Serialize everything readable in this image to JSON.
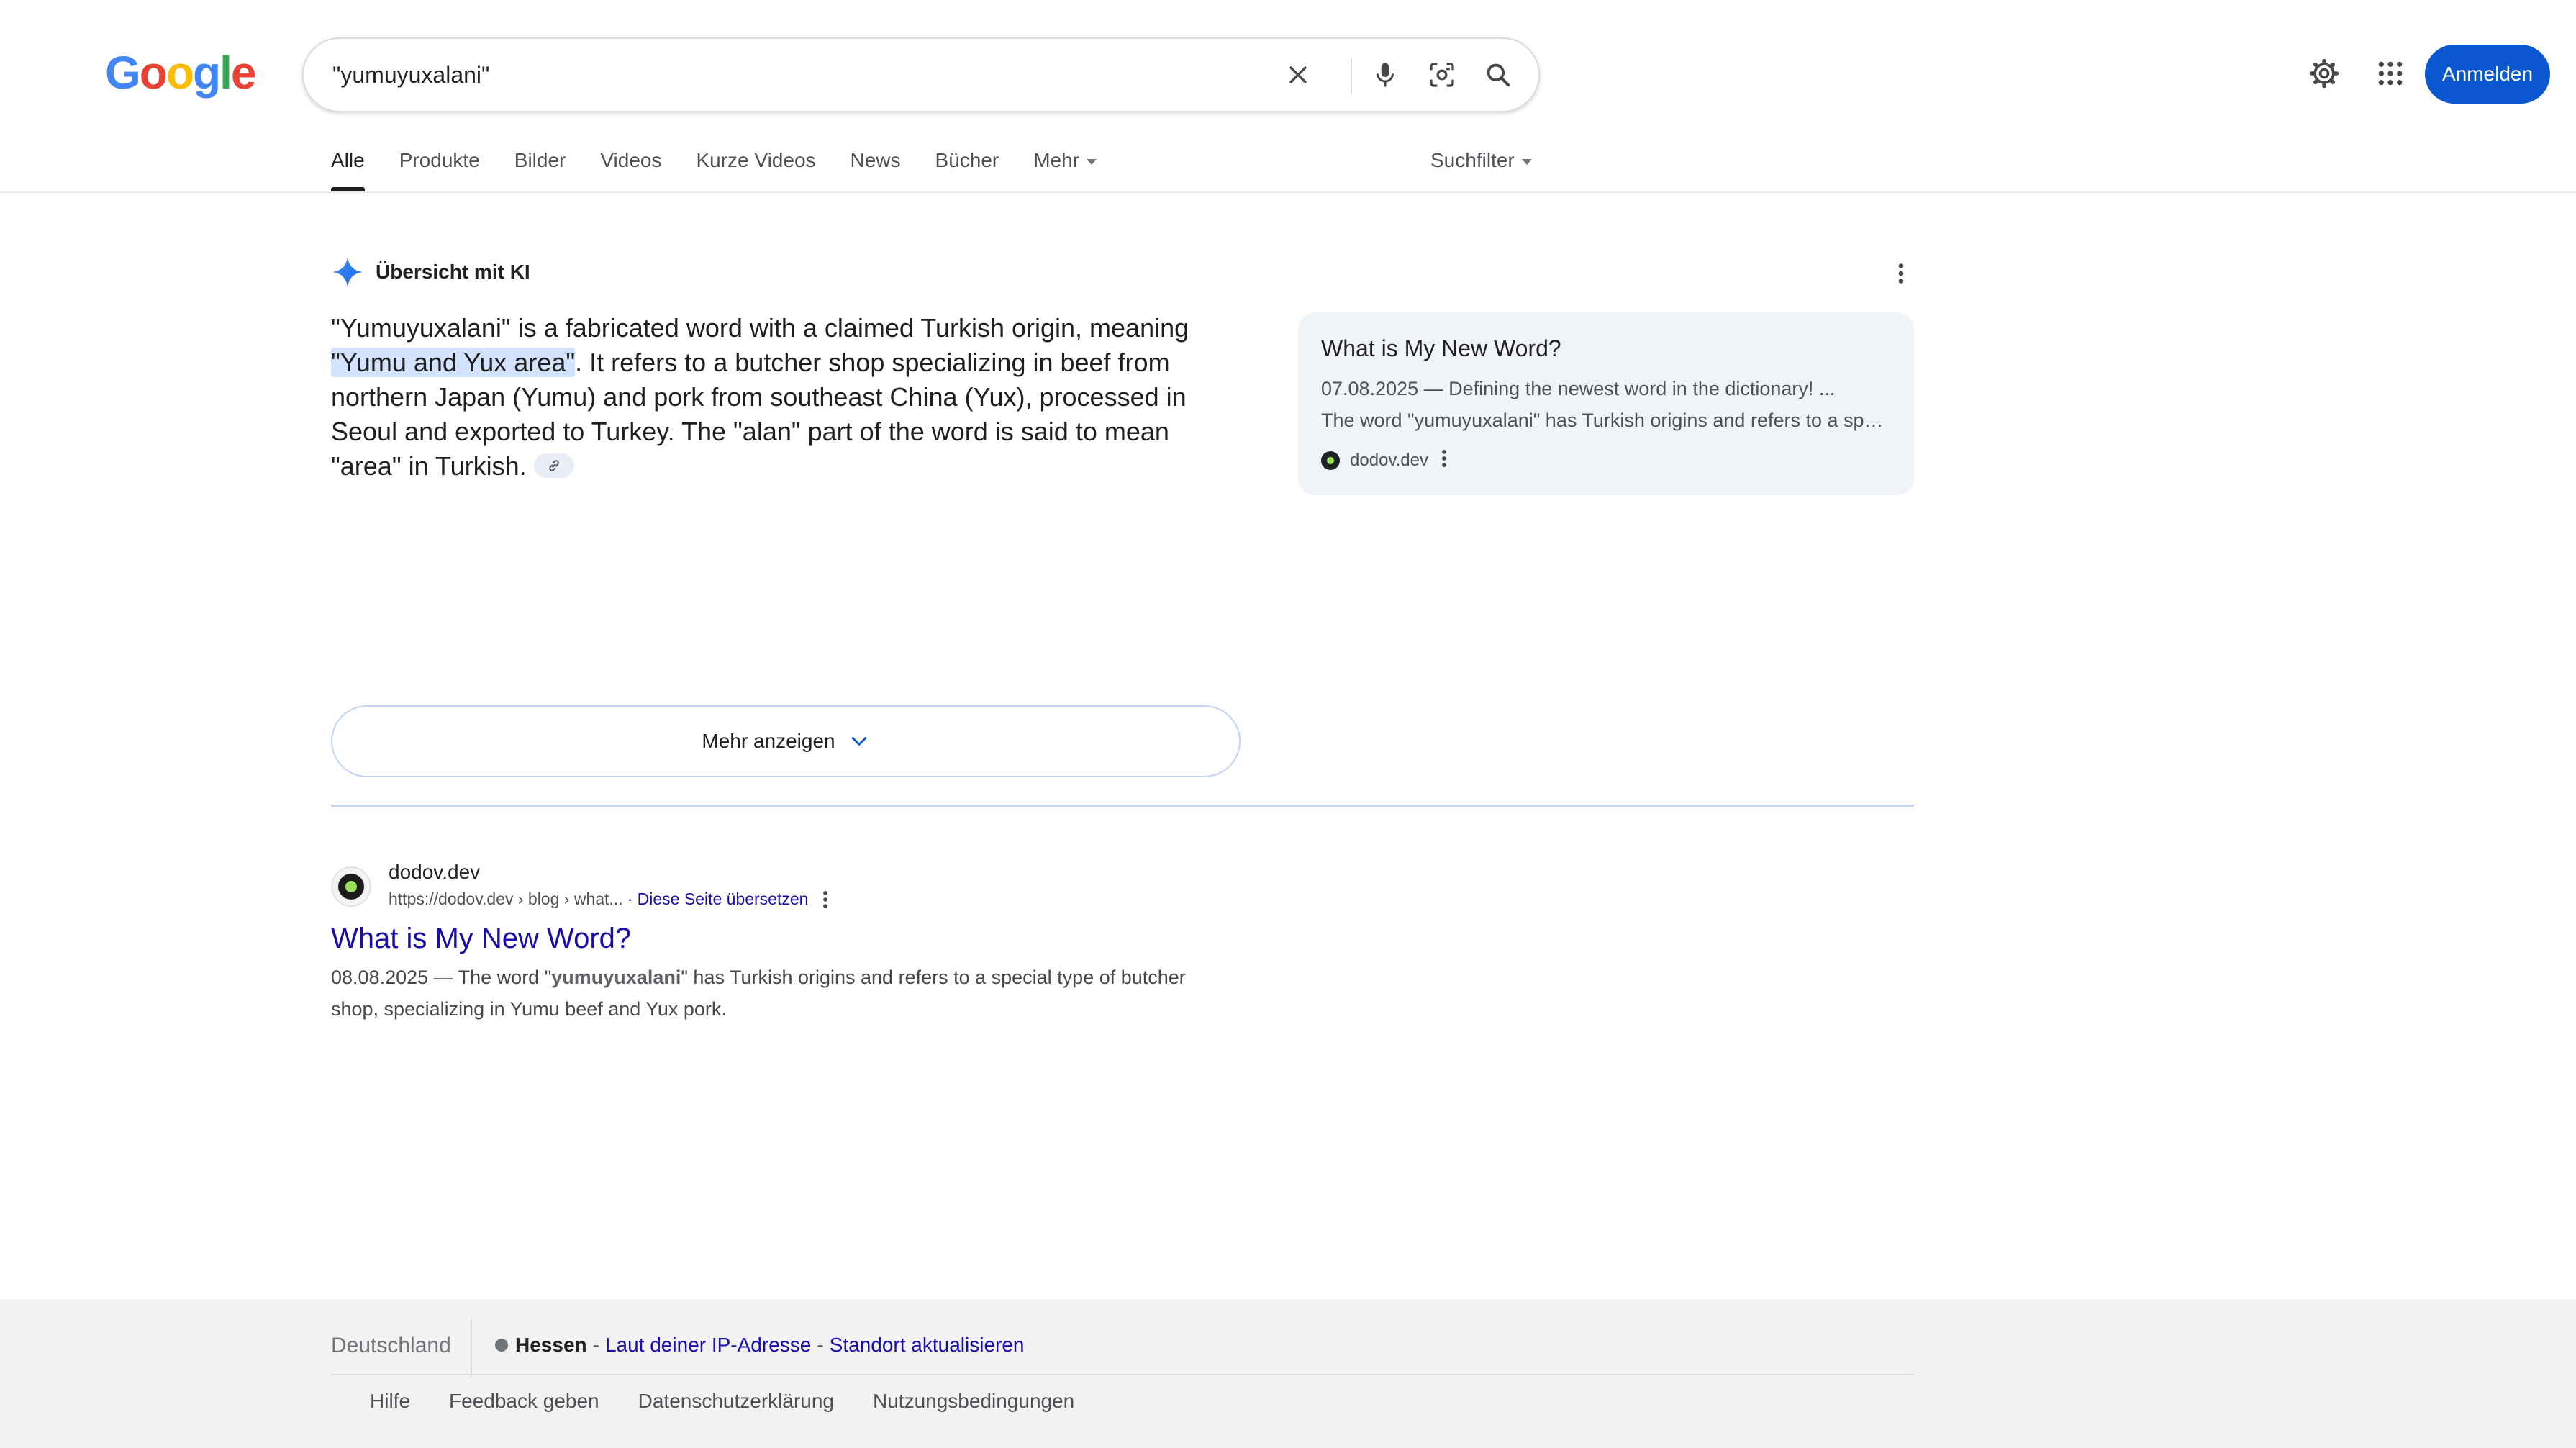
{
  "header": {
    "logo": {
      "letters": [
        {
          "char": "G",
          "color": "#4285f4"
        },
        {
          "char": "o",
          "color": "#ea4335"
        },
        {
          "char": "o",
          "color": "#fbbc05"
        },
        {
          "char": "g",
          "color": "#4285f4"
        },
        {
          "char": "l",
          "color": "#34a853"
        },
        {
          "char": "e",
          "color": "#ea4335"
        }
      ]
    },
    "search": {
      "query": "\"yumuyuxalani\"",
      "icons": [
        "close-icon",
        "microphone-icon",
        "lens-icon",
        "search-icon"
      ]
    },
    "icons": [
      "settings-icon",
      "apps-grid-icon"
    ],
    "signin_label": "Anmelden"
  },
  "tabs": [
    {
      "label": "Alle",
      "active": true
    },
    {
      "label": "Produkte"
    },
    {
      "label": "Bilder"
    },
    {
      "label": "Videos"
    },
    {
      "label": "Kurze Videos"
    },
    {
      "label": "News"
    },
    {
      "label": "Bücher"
    },
    {
      "label": "Mehr"
    }
  ],
  "filter_label": "Suchfilter",
  "ai_overview": {
    "title": "Übersicht mit KI",
    "text_before": "\"Yumuyuxalani\" is a fabricated word with a claimed Turkish origin, meaning ",
    "text_highlight": "\"Yumu and Yux area\"",
    "text_after": ". It refers to a butcher shop specializing in beef from northern Japan (Yumu) and pork from southeast China (Yux), processed in Seoul and exported to Turkey. The \"alan\" part of the word is said to mean \"area\" in Turkish.",
    "source_card": {
      "title": "What is My New Word?",
      "line1": "07.08.2025 — Defining the newest word in the dictionary! ...",
      "line2": "The word \"yumuyuxalani\" has Turkish origins and refers to a special type of butcher shop, specializing in Yumu beef and Yux pork.",
      "site": "dodov.dev"
    },
    "show_more_label": "Mehr anzeigen"
  },
  "result": {
    "site": "dodov.dev",
    "url": "https://dodov.dev › blog › what...",
    "translate_label": "· Diese Seite übersetzen",
    "title": "What is My New Word?",
    "snippet_prefix": "08.08.2025 — The word \"",
    "snippet_bold": "yumuyuxalani",
    "snippet_suffix": "\" has Turkish origins and refers to a special type of butcher shop, specializing in Yumu beef and Yux pork."
  },
  "footer": {
    "country": "Deutschland",
    "region": "Hessen",
    "ip_label": "Laut deiner IP-Adresse",
    "update_label": "Standort aktualisieren",
    "dash": "-",
    "links": [
      "Hilfe",
      "Feedback geben",
      "Datenschutzerklärung",
      "Nutzungsbedingungen"
    ]
  }
}
